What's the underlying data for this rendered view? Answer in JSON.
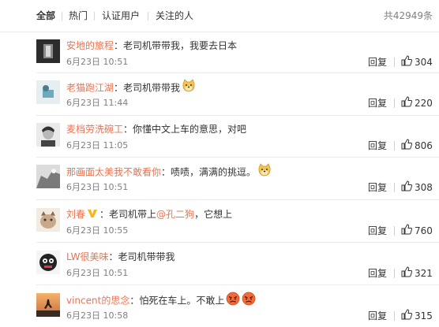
{
  "tabs": [
    {
      "label": "全部"
    },
    {
      "label": "热门"
    },
    {
      "label": "认证用户"
    },
    {
      "label": "关注的人"
    }
  ],
  "count_label": "共42949条",
  "reply_label": "回复",
  "comments": [
    {
      "user": "安地的旅程",
      "sep": "：",
      "text": "老司机带带我，我要去日本",
      "time": "6月23日 10:51",
      "likes": "304"
    },
    {
      "user": "老猫跑江湖",
      "sep": "：",
      "text": "老司机带带我",
      "emoji": "doge-icon",
      "time": "6月23日 11:44",
      "likes": "220"
    },
    {
      "user": "麦档劳洗碗工",
      "sep": "：",
      "text": "你懂中文上车的意思，对吧",
      "time": "6月23日 11:05",
      "likes": "806"
    },
    {
      "user": "那画面太美我不敢看你",
      "sep": "：",
      "text": "啧啧，满满的挑逗。",
      "emoji": "doge-icon",
      "time": "6月23日 10:51",
      "likes": "308"
    },
    {
      "user": "刘春",
      "sep": "：",
      "text_before": "老司机带上",
      "mention": "@孔二狗",
      "text_after": "，它想上",
      "time": "6月23日 10:55",
      "likes": "760"
    },
    {
      "user": "LW很美味",
      "sep": "：",
      "text": "老司机带带我",
      "time": "6月23日 10:51",
      "likes": "321"
    },
    {
      "user": "vincent的思念",
      "sep": "：",
      "text": "怕死在车上。不敢上",
      "emoji": "angry-face-icon",
      "time": "6月23日 10:58",
      "likes": "315"
    }
  ]
}
